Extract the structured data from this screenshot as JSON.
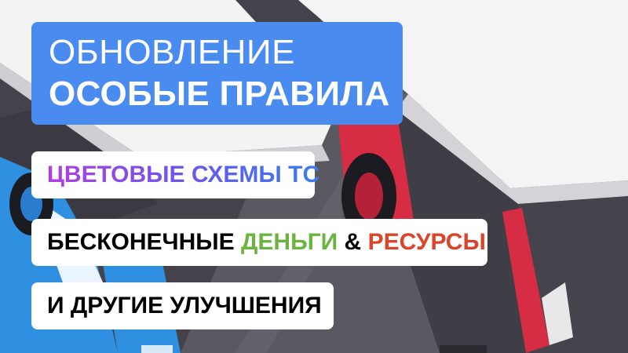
{
  "title": {
    "line1": "ОБНОВЛЕНИЕ",
    "line2": "ОСОБЫЕ ПРАВИЛА"
  },
  "features": {
    "color_schemes": "ЦВЕТОВЫЕ СХЕМЫ ТС",
    "endless_prefix": "БЕСКОНЕЧНЫЕ ",
    "money": "ДЕНЬГИ",
    "amp": " & ",
    "resources": "РЕСУРСЫ",
    "other": "И ДРУГИЕ УЛУЧШЕНИЯ"
  },
  "colors": {
    "title_bg": "#4a8bf0",
    "money": "#6cb43f",
    "resources": "#d9442a",
    "gradient_start": "#b23de0",
    "gradient_end": "#3a7cf0",
    "bus_left": "#2f8fe0",
    "bus_right": "#d62c44"
  }
}
